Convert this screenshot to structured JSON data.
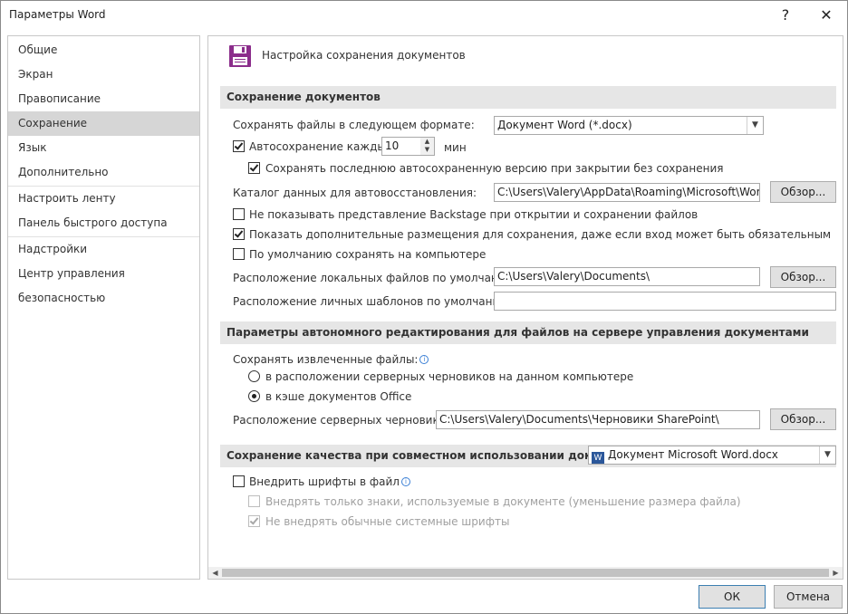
{
  "window": {
    "title": "Параметры Word",
    "help_label": "?",
    "close_label": "✕"
  },
  "sidebar": {
    "items": [
      {
        "label": "Общие"
      },
      {
        "label": "Экран"
      },
      {
        "label": "Правописание"
      },
      {
        "label": "Сохранение",
        "active": true
      },
      {
        "label": "Язык"
      },
      {
        "label": "Дополнительно"
      },
      {
        "label": "Настроить ленту"
      },
      {
        "label": "Панель быстрого доступа"
      },
      {
        "label": "Надстройки"
      },
      {
        "label": "Центр управления безопасностью"
      }
    ]
  },
  "header": {
    "title": "Настройка сохранения документов",
    "icon": "floppy-disk-icon"
  },
  "save_docs": {
    "section_title": "Сохранение документов",
    "format_label": "Сохранять файлы в следующем формате:",
    "format_value": "Документ Word (*.docx)",
    "autosave_label": "Автосохранение каждые",
    "autosave_checked": true,
    "autosave_value": "10",
    "autosave_unit": "мин",
    "keep_last_label": "Сохранять последнюю автосохраненную версию при закрытии без сохранения",
    "keep_last_checked": true,
    "autorecover_label": "Каталог данных для автовосстановления:",
    "autorecover_value": "C:\\Users\\Valery\\AppData\\Roaming\\Microsoft\\Word\\",
    "browse_label": "Обзор...",
    "no_backstage_label": "Не показывать представление Backstage при открытии и сохранении файлов",
    "no_backstage_checked": false,
    "show_places_label": "Показать дополнительные размещения для сохранения, даже если вход может быть обязательным",
    "show_places_checked": true,
    "save_to_computer_label": "По умолчанию сохранять на компьютере",
    "save_to_computer_checked": false,
    "local_files_label": "Расположение локальных файлов по умолчанию:",
    "local_files_value": "C:\\Users\\Valery\\Documents\\",
    "templates_label": "Расположение личных шаблонов по умолчанию:",
    "templates_value": ""
  },
  "offline": {
    "section_title": "Параметры автономного редактирования для файлов на сервере управления документами",
    "checkout_label": "Сохранять извлеченные файлы:",
    "radio_server_label": "в расположении серверных черновиков на данном компьютере",
    "radio_cache_label": "в кэше документов Office",
    "selected": "cache",
    "drafts_label": "Расположение серверных черновиков:",
    "drafts_value": "C:\\Users\\Valery\\Documents\\Черновики SharePoint\\"
  },
  "fidelity": {
    "section_title": "Сохранение качества при совместном использовании документа:",
    "doc_value": "Документ Microsoft Word.docx",
    "embed_label": "Внедрить шрифты в файл",
    "embed_checked": false,
    "only_used_label": "Внедрять только знаки, используемые в документе (уменьшение размера файла)",
    "only_used_checked": false,
    "no_common_label": "Не внедрять обычные системные шрифты",
    "no_common_checked": true
  },
  "footer": {
    "ok_label": "ОК",
    "cancel_label": "Отмена"
  },
  "colors": {
    "accent": "#8b2d8b",
    "section_bg": "#e6e6e6",
    "selected_nav": "#d6d6d6"
  }
}
